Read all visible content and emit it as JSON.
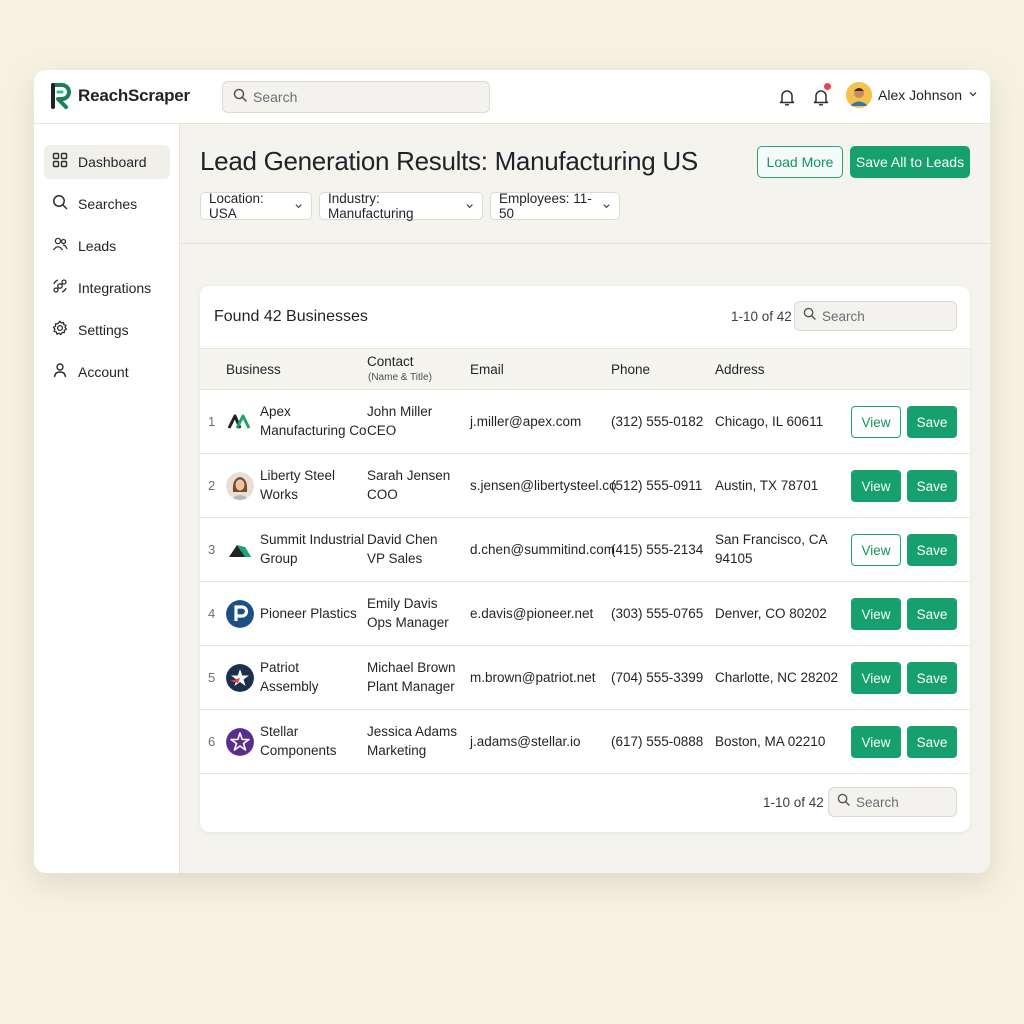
{
  "app": {
    "name": "ReachScraper"
  },
  "topbar": {
    "search_placeholder": "Search",
    "user_name": "Alex Johnson"
  },
  "sidebar": {
    "items": [
      {
        "label": "Dashboard",
        "icon": "grid-icon",
        "active": true
      },
      {
        "label": "Searches",
        "icon": "search-icon"
      },
      {
        "label": "Leads",
        "icon": "users-icon"
      },
      {
        "label": "Integrations",
        "icon": "integrations-icon"
      },
      {
        "label": "Settings",
        "icon": "gear-icon"
      },
      {
        "label": "Account",
        "icon": "user-icon"
      }
    ]
  },
  "header": {
    "title": "Lead Generation Results: Manufacturing US",
    "load_more_label": "Load More",
    "save_all_label": "Save All to Leads",
    "filters": [
      "Location: USA",
      "Industry: Manufacturing",
      "Employees: 11-50"
    ]
  },
  "results": {
    "title": "Found 42 Businesses",
    "pager_top": "1-10 of 42",
    "pager_bottom": "1-10 of 42",
    "search_placeholder": "Search",
    "columns": {
      "business": "Business",
      "contact": "Contact",
      "contact_sub": "(Name & Title)",
      "email": "Email",
      "phone": "Phone",
      "address": "Address"
    },
    "view_label": "View",
    "save_label": "Save",
    "rows": [
      {
        "num": "1",
        "business_l1": "Apex",
        "business_l2": "Manufacturing Co",
        "contact_name": "John Miller",
        "contact_title": "CEO",
        "email": "j.miller@apex.com",
        "phone": "(312) 555-0182",
        "addr_l1": "Chicago, IL 60611",
        "addr_l2": "",
        "logo": "apex-logo",
        "view_style": "outline"
      },
      {
        "num": "2",
        "business_l1": "Liberty Steel",
        "business_l2": "Works",
        "contact_name": "Sarah Jensen",
        "contact_title": "COO",
        "email": "s.jensen@libertysteel.co",
        "phone": "(512) 555-0911",
        "addr_l1": "Austin, TX 78701",
        "addr_l2": "",
        "logo": "liberty-portrait",
        "view_style": "filled"
      },
      {
        "num": "3",
        "business_l1": "Summit Industrial",
        "business_l2": "Group",
        "contact_name": "David Chen",
        "contact_title": "VP Sales",
        "email": "d.chen@summitind.com",
        "phone": "(415) 555-2134",
        "addr_l1": "San Francisco, CA",
        "addr_l2": "94105",
        "logo": "summit-logo",
        "view_style": "outline"
      },
      {
        "num": "4",
        "business_l1": "Pioneer Plastics",
        "business_l2": "",
        "contact_name": "Emily Davis",
        "contact_title": "Ops Manager",
        "email": "e.davis@pioneer.net",
        "phone": "(303) 555-0765",
        "addr_l1": "Denver, CO 80202",
        "addr_l2": "",
        "logo": "pioneer-logo",
        "view_style": "filled"
      },
      {
        "num": "5",
        "business_l1": "Patriot",
        "business_l2": "Assembly",
        "contact_name": "Michael Brown",
        "contact_title": "Plant Manager",
        "email": "m.brown@patriot.net",
        "phone": "(704) 555-3399",
        "addr_l1": "Charlotte, NC 28202",
        "addr_l2": "",
        "logo": "patriot-logo",
        "view_style": "filled"
      },
      {
        "num": "6",
        "business_l1": "Stellar",
        "business_l2": "Components",
        "contact_name": "Jessica Adams",
        "contact_title": "Marketing",
        "email": "j.adams@stellar.io",
        "phone": "(617) 555-0888",
        "addr_l1": "Boston, MA 02210",
        "addr_l2": "",
        "logo": "stellar-logo",
        "view_style": "filled"
      }
    ]
  },
  "colors": {
    "accent": "#15a06e",
    "notification": "#e8454f",
    "background": "#f6f1e2"
  }
}
